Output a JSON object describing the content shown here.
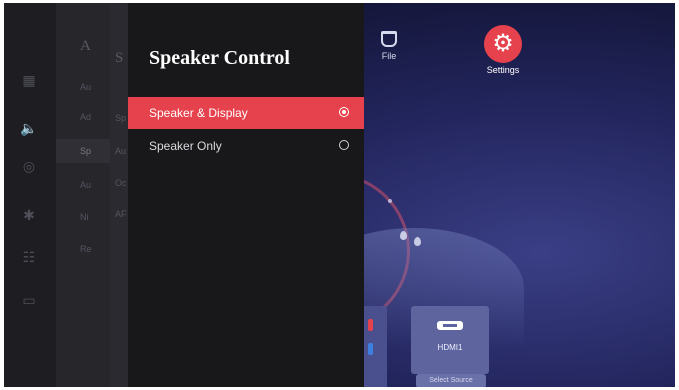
{
  "background": {
    "top_items": [
      {
        "label": "File",
        "icon": "file-icon"
      },
      {
        "label": "Settings",
        "icon": "gear-icon"
      }
    ],
    "source_card": {
      "label": "HDMI1",
      "action": "Select Source",
      "icon": "hdmi-icon"
    }
  },
  "sidebar": {
    "icons": [
      "picture-icon",
      "sound-icon",
      "network-icon",
      "bluetooth-icon",
      "apps-icon",
      "display-icon"
    ],
    "active_icon": "sound-icon"
  },
  "ghost_menu": {
    "header": "A",
    "items": [
      "Au",
      "Ad",
      "Sp",
      "Au",
      "Ni",
      "Re"
    ]
  },
  "ghost_submenu": {
    "header": "S",
    "items": [
      "Sp",
      "Au",
      "Oc",
      "AF"
    ]
  },
  "dialog": {
    "title": "Speaker Control",
    "options": [
      {
        "label": "Speaker & Display",
        "selected": true
      },
      {
        "label": "Speaker Only",
        "selected": false
      }
    ]
  },
  "colors": {
    "accent": "#e5424d",
    "overlay": "#18181b",
    "background_deep": "#14163a"
  }
}
